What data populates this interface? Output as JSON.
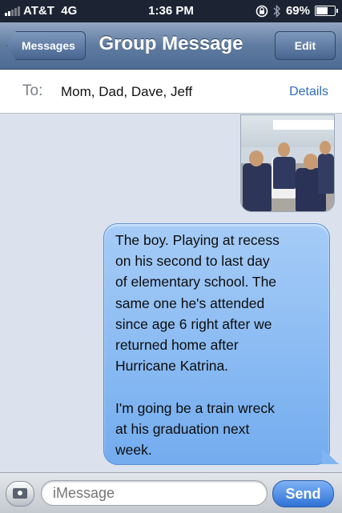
{
  "status_bar": {
    "carrier": "AT&T",
    "network": "4G",
    "time": "1:36 PM",
    "battery": "69%",
    "battery_level": 0.69,
    "icons": [
      "signal-icon",
      "rotation-lock-icon",
      "bluetooth-icon",
      "battery-icon"
    ]
  },
  "nav": {
    "back_label": "Messages",
    "title": "Group Message",
    "edit_label": "Edit"
  },
  "to_bar": {
    "label": "To:",
    "recipients": "Mom, Dad, Dave, Jeff",
    "details_label": "Details"
  },
  "messages": [
    {
      "type": "photo",
      "sender": "me"
    },
    {
      "type": "text",
      "sender": "me",
      "text": "The boy. Playing at recess\non his second to last day\nof elementary school. The\nsame one he's attended\nsince age 6 right after we\nreturned home after\nHurricane Katrina.\n\nI'm going be a train wreck\nat his graduation next\nweek."
    }
  ],
  "composer": {
    "placeholder": "iMessage",
    "send_label": "Send",
    "camera_icon": "camera-icon"
  },
  "colors": {
    "nav_blue": "#5f7ba0",
    "bubble_blue": "#8dbdf4",
    "background": "#dbe2ed",
    "details_link": "#2f6eb9"
  }
}
